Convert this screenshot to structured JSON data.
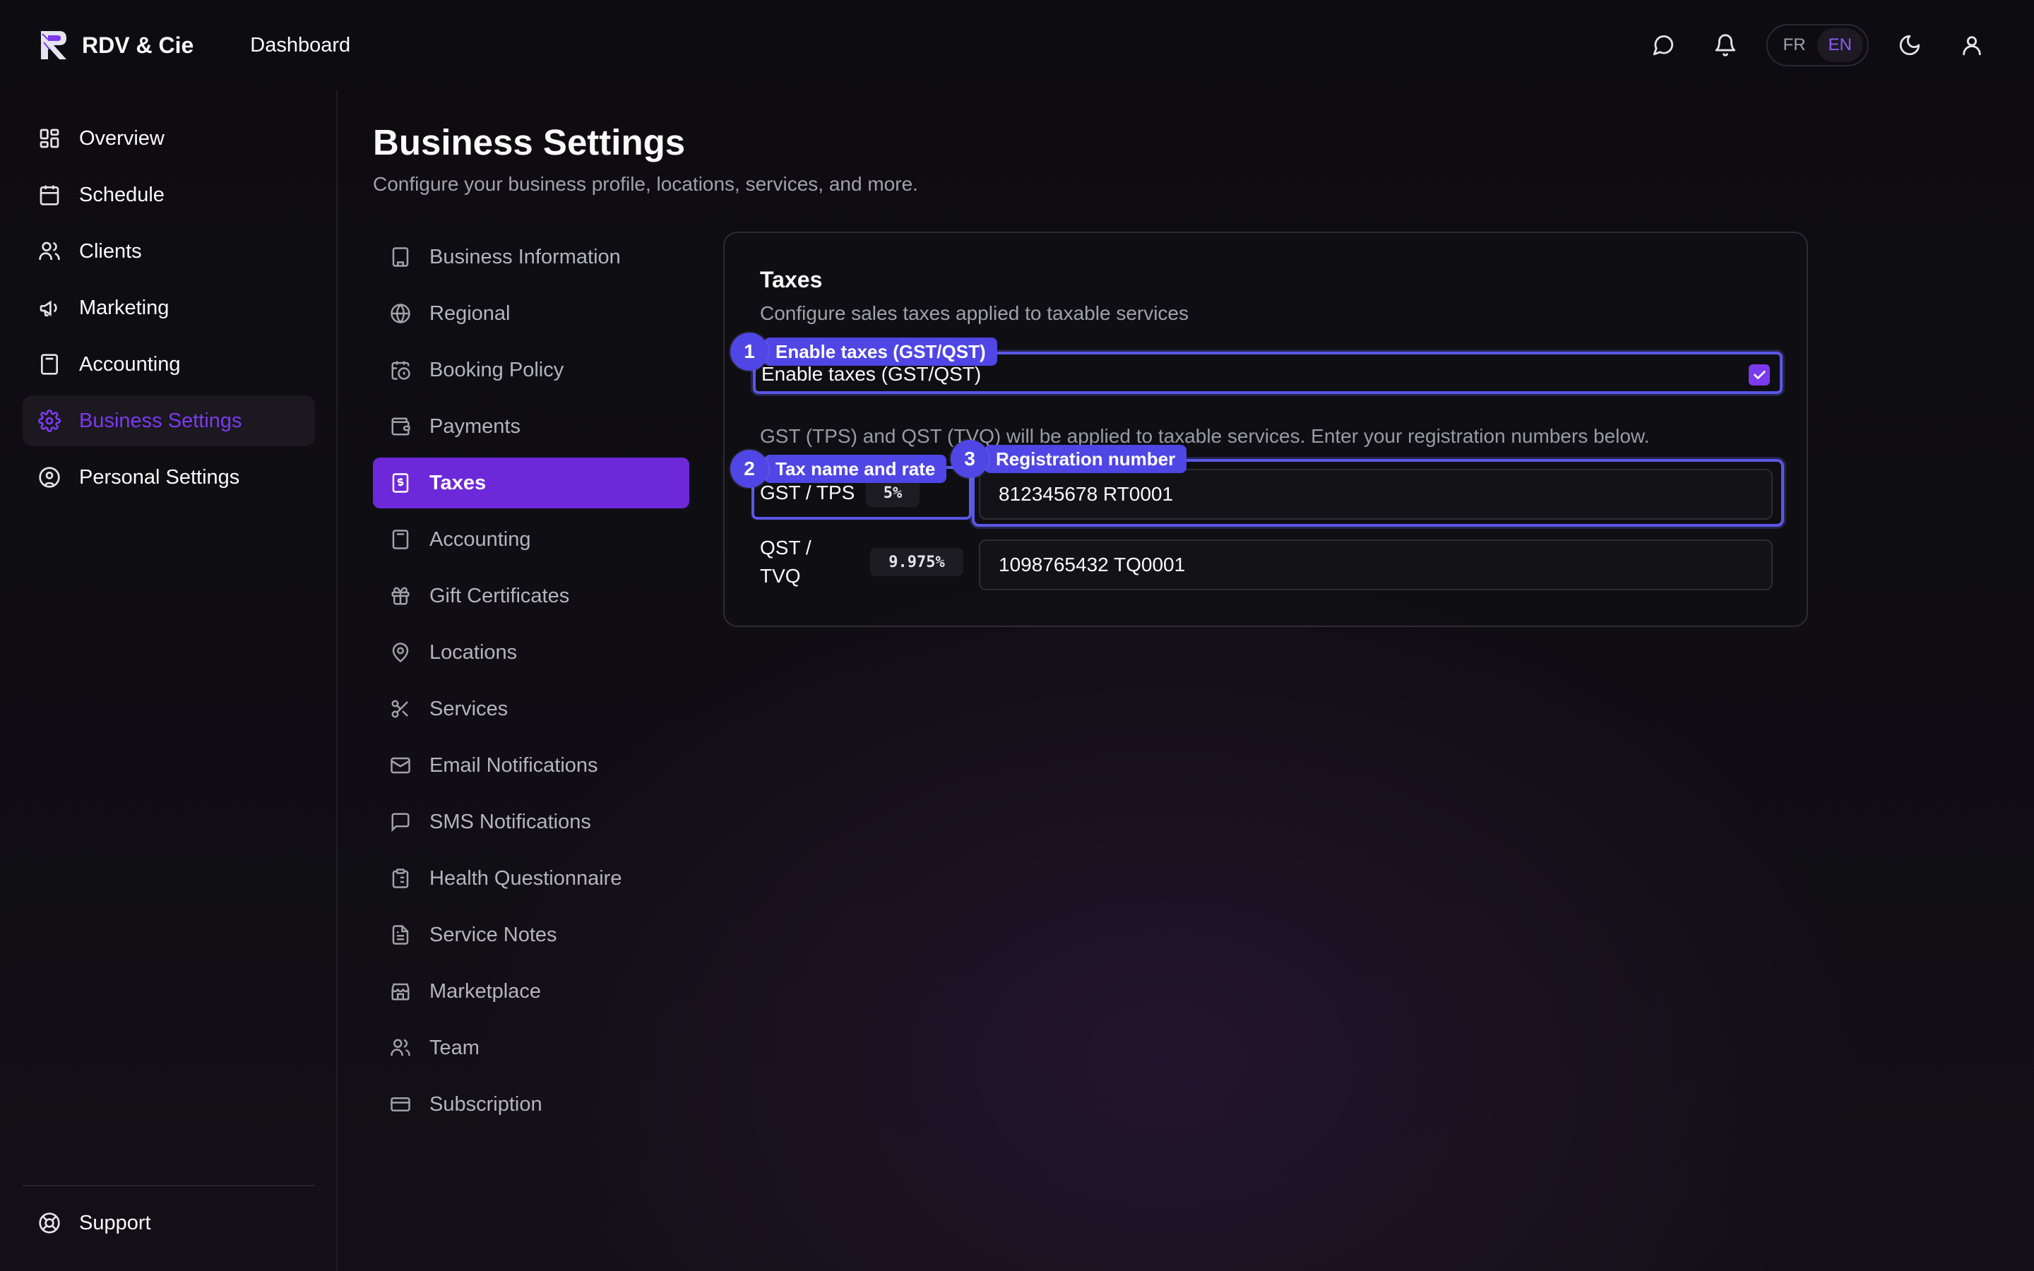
{
  "app": {
    "brand": "RDV & Cie",
    "section_title": "Dashboard"
  },
  "topbar": {
    "icons": [
      "chat-bubble-icon",
      "bell-icon",
      "moon-icon",
      "user-icon"
    ],
    "lang": {
      "fr": "FR",
      "en": "EN",
      "active": "EN"
    }
  },
  "sidebar": {
    "items": [
      {
        "label": "Overview",
        "icon": "layout-grid-icon"
      },
      {
        "label": "Schedule",
        "icon": "calendar-icon"
      },
      {
        "label": "Clients",
        "icon": "users-icon"
      },
      {
        "label": "Marketing",
        "icon": "megaphone-icon"
      },
      {
        "label": "Accounting",
        "icon": "calculator-icon"
      },
      {
        "label": "Business Settings",
        "icon": "gear-icon",
        "active": true
      },
      {
        "label": "Personal Settings",
        "icon": "user-circle-icon"
      }
    ],
    "support": {
      "label": "Support",
      "icon": "lifebuoy-icon"
    }
  },
  "page": {
    "title": "Business Settings",
    "subtitle": "Configure your business profile, locations, services, and more."
  },
  "settings_nav": {
    "items": [
      {
        "label": "Business Information",
        "icon": "building-icon"
      },
      {
        "label": "Regional",
        "icon": "globe-icon"
      },
      {
        "label": "Booking Policy",
        "icon": "calendar-clock-icon"
      },
      {
        "label": "Payments",
        "icon": "wallet-icon"
      },
      {
        "label": "Taxes",
        "icon": "receipt-dollar-icon",
        "active": true
      },
      {
        "label": "Accounting",
        "icon": "calculator-icon"
      },
      {
        "label": "Gift Certificates",
        "icon": "gift-icon"
      },
      {
        "label": "Locations",
        "icon": "map-pin-icon"
      },
      {
        "label": "Services",
        "icon": "scissors-icon"
      },
      {
        "label": "Email Notifications",
        "icon": "mail-icon"
      },
      {
        "label": "SMS Notifications",
        "icon": "message-square-icon"
      },
      {
        "label": "Health Questionnaire",
        "icon": "clipboard-icon"
      },
      {
        "label": "Service Notes",
        "icon": "file-text-icon"
      },
      {
        "label": "Marketplace",
        "icon": "store-icon"
      },
      {
        "label": "Team",
        "icon": "users-icon"
      },
      {
        "label": "Subscription",
        "icon": "credit-card-icon"
      }
    ]
  },
  "taxes_card": {
    "title": "Taxes",
    "description": "Configure sales taxes applied to taxable services",
    "enable_label": "Enable taxes (GST/QST)",
    "enabled": true,
    "info": "GST (TPS) and QST (TVQ) will be applied to taxable services. Enter your registration numbers below.",
    "taxes": [
      {
        "name": "GST / TPS",
        "rate": "5%",
        "registration": "812345678 RT0001"
      },
      {
        "name_line1": "QST /",
        "name_line2": "TVQ",
        "rate": "9.975%",
        "registration": "1098765432 TQ0001"
      }
    ]
  },
  "annotations": [
    {
      "num": "1",
      "label": "Enable taxes (GST/QST)"
    },
    {
      "num": "2",
      "label": "Tax name and rate"
    },
    {
      "num": "3",
      "label": "Registration number"
    }
  ],
  "colors": {
    "accent": "#7c3aed",
    "annotation": "#4f46e5",
    "bg": "#0f0e12"
  }
}
